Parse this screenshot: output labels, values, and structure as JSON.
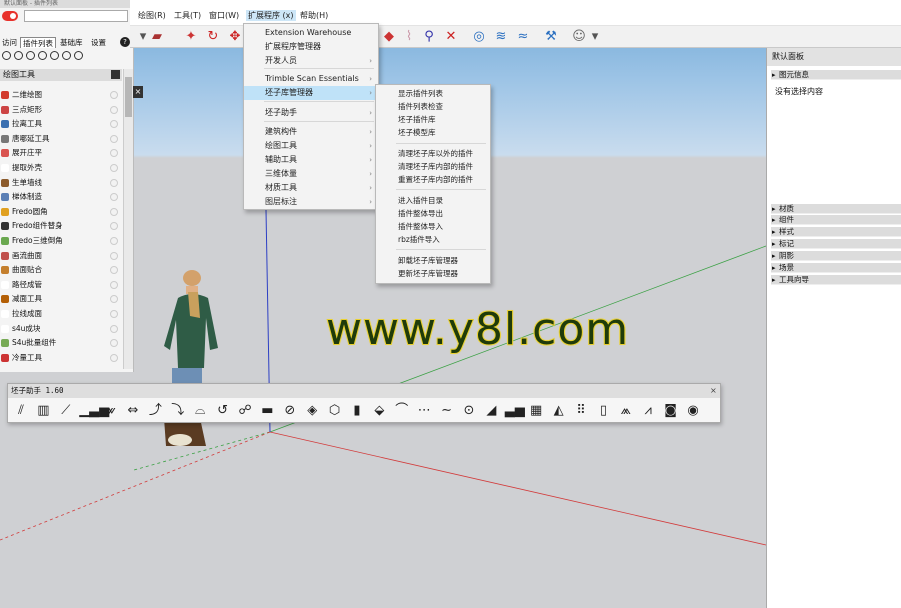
{
  "tray": {
    "title": "默认面板 - 插件列表",
    "tabs": [
      "访问",
      "插件列表",
      "基础库",
      "设置"
    ],
    "active_tab": "插件列表",
    "help": "?",
    "header": "绘图工具",
    "items": [
      {
        "label": "二维绘图",
        "color": "#d23b2e"
      },
      {
        "label": "三点矩形",
        "color": "#c44"
      },
      {
        "label": "拉离工具",
        "color": "#3a6fb0"
      },
      {
        "label": "唐哪延工具",
        "color": "#777"
      },
      {
        "label": "展开庄平",
        "color": "#d9534f"
      },
      {
        "label": "提取外壳",
        "color": "#ffffff"
      },
      {
        "label": "生单墙线",
        "color": "#8b5a2b"
      },
      {
        "label": "梯体制造",
        "color": "#5b7fb5"
      },
      {
        "label": "Fredo圆角",
        "color": "#e0a020"
      },
      {
        "label": "Fredo组件替身",
        "color": "#333333"
      },
      {
        "label": "Fredo三维倒角",
        "color": "#6aa84f"
      },
      {
        "label": "画流曲面",
        "color": "#c0504d"
      },
      {
        "label": "曲面贴合",
        "color": "#c47f2d"
      },
      {
        "label": "路径成管",
        "color": "#ffffff"
      },
      {
        "label": "减面工具",
        "color": "#b45f06"
      },
      {
        "label": "拉线成面",
        "color": "#ffffff"
      },
      {
        "label": "s4u成块",
        "color": "#ffffff"
      },
      {
        "label": "S4u批量组件",
        "color": "#7a5"
      },
      {
        "label": "冷量工具",
        "color": "#c33"
      }
    ]
  },
  "menubar": [
    "绘图(R)",
    "工具(T)",
    "窗口(W)",
    "扩展程序 (x)",
    "帮助(H)"
  ],
  "dropdown": {
    "items": [
      {
        "label": "Extension Warehouse",
        "submenu": false
      },
      {
        "label": "扩展程序管理器",
        "submenu": false
      },
      {
        "label": "开发人员",
        "submenu": true
      },
      {
        "label": "Trimble Scan Essentials",
        "submenu": true
      },
      {
        "label": "坯子库管理器",
        "submenu": true,
        "highlighted": true
      },
      {
        "label": "坯子助手",
        "submenu": true
      },
      {
        "label": "建筑构件",
        "submenu": true
      },
      {
        "label": "绘图工具",
        "submenu": true
      },
      {
        "label": "辅助工具",
        "submenu": true
      },
      {
        "label": "三维体量",
        "submenu": true
      },
      {
        "label": "材质工具",
        "submenu": true
      },
      {
        "label": "图层标注",
        "submenu": true
      }
    ]
  },
  "submenu": {
    "items": [
      "显示插件列表",
      "插件列表检查",
      "坯子插件库",
      "坯子模型库",
      "清理坯子库以外的插件",
      "清理坯子库内部的插件",
      "重置坯子库内部的插件",
      "进入插件目录",
      "插件整体导出",
      "插件整体导入",
      "rbz插件导入",
      "卸载坯子库管理器",
      "更新坯子库管理器"
    ]
  },
  "right_panel": {
    "title": "默认面板",
    "entity_info": "图元信息",
    "no_selection": "没有选择内容",
    "sections": [
      "材质",
      "组件",
      "样式",
      "标记",
      "阴影",
      "场景",
      "工具向导"
    ]
  },
  "helper_toolbar": {
    "title": "坯子助手 1.60",
    "close": "×"
  },
  "watermark": "www.y8l.com",
  "colors": {
    "highlight": "#bfe2f8",
    "axis_red": "#d23b3b",
    "axis_green": "#3aa043",
    "axis_blue": "#2d3fc4",
    "sky": "#9dc4e6",
    "ground": "#cfd0d3"
  }
}
